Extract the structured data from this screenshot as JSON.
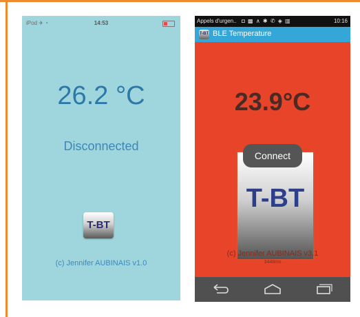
{
  "ios": {
    "status": {
      "left": "iPod ✈ ◔",
      "time": "14:53"
    },
    "temperature": "26.2 °C",
    "connection_state": "Disconnected",
    "logo_text": "T-BT",
    "copyright": "(c) Jennifer AUBINAIS v1.0"
  },
  "android": {
    "status": {
      "notification": "Appels d'urgen..",
      "icons": "◘ ▩ ∧ ✱ ✆ ◈ ▥",
      "clock": "10:16"
    },
    "app_title": "BLE Temperature",
    "app_icon_text": "T-BT",
    "temperature": "23.9°C",
    "connect_label": "Connect",
    "logo_text": "T-BT",
    "copyright": "(c) Jennifer AUBINAIS v3.1",
    "subtext": "3448ms",
    "nav": {
      "back": "back-icon",
      "home": "home-icon",
      "recents": "recents-icon"
    }
  },
  "colors": {
    "frame": "#f08a2e",
    "ios_background": "#9fd6de",
    "android_background": "#e8442a",
    "android_actionbar": "#35a6d8"
  }
}
